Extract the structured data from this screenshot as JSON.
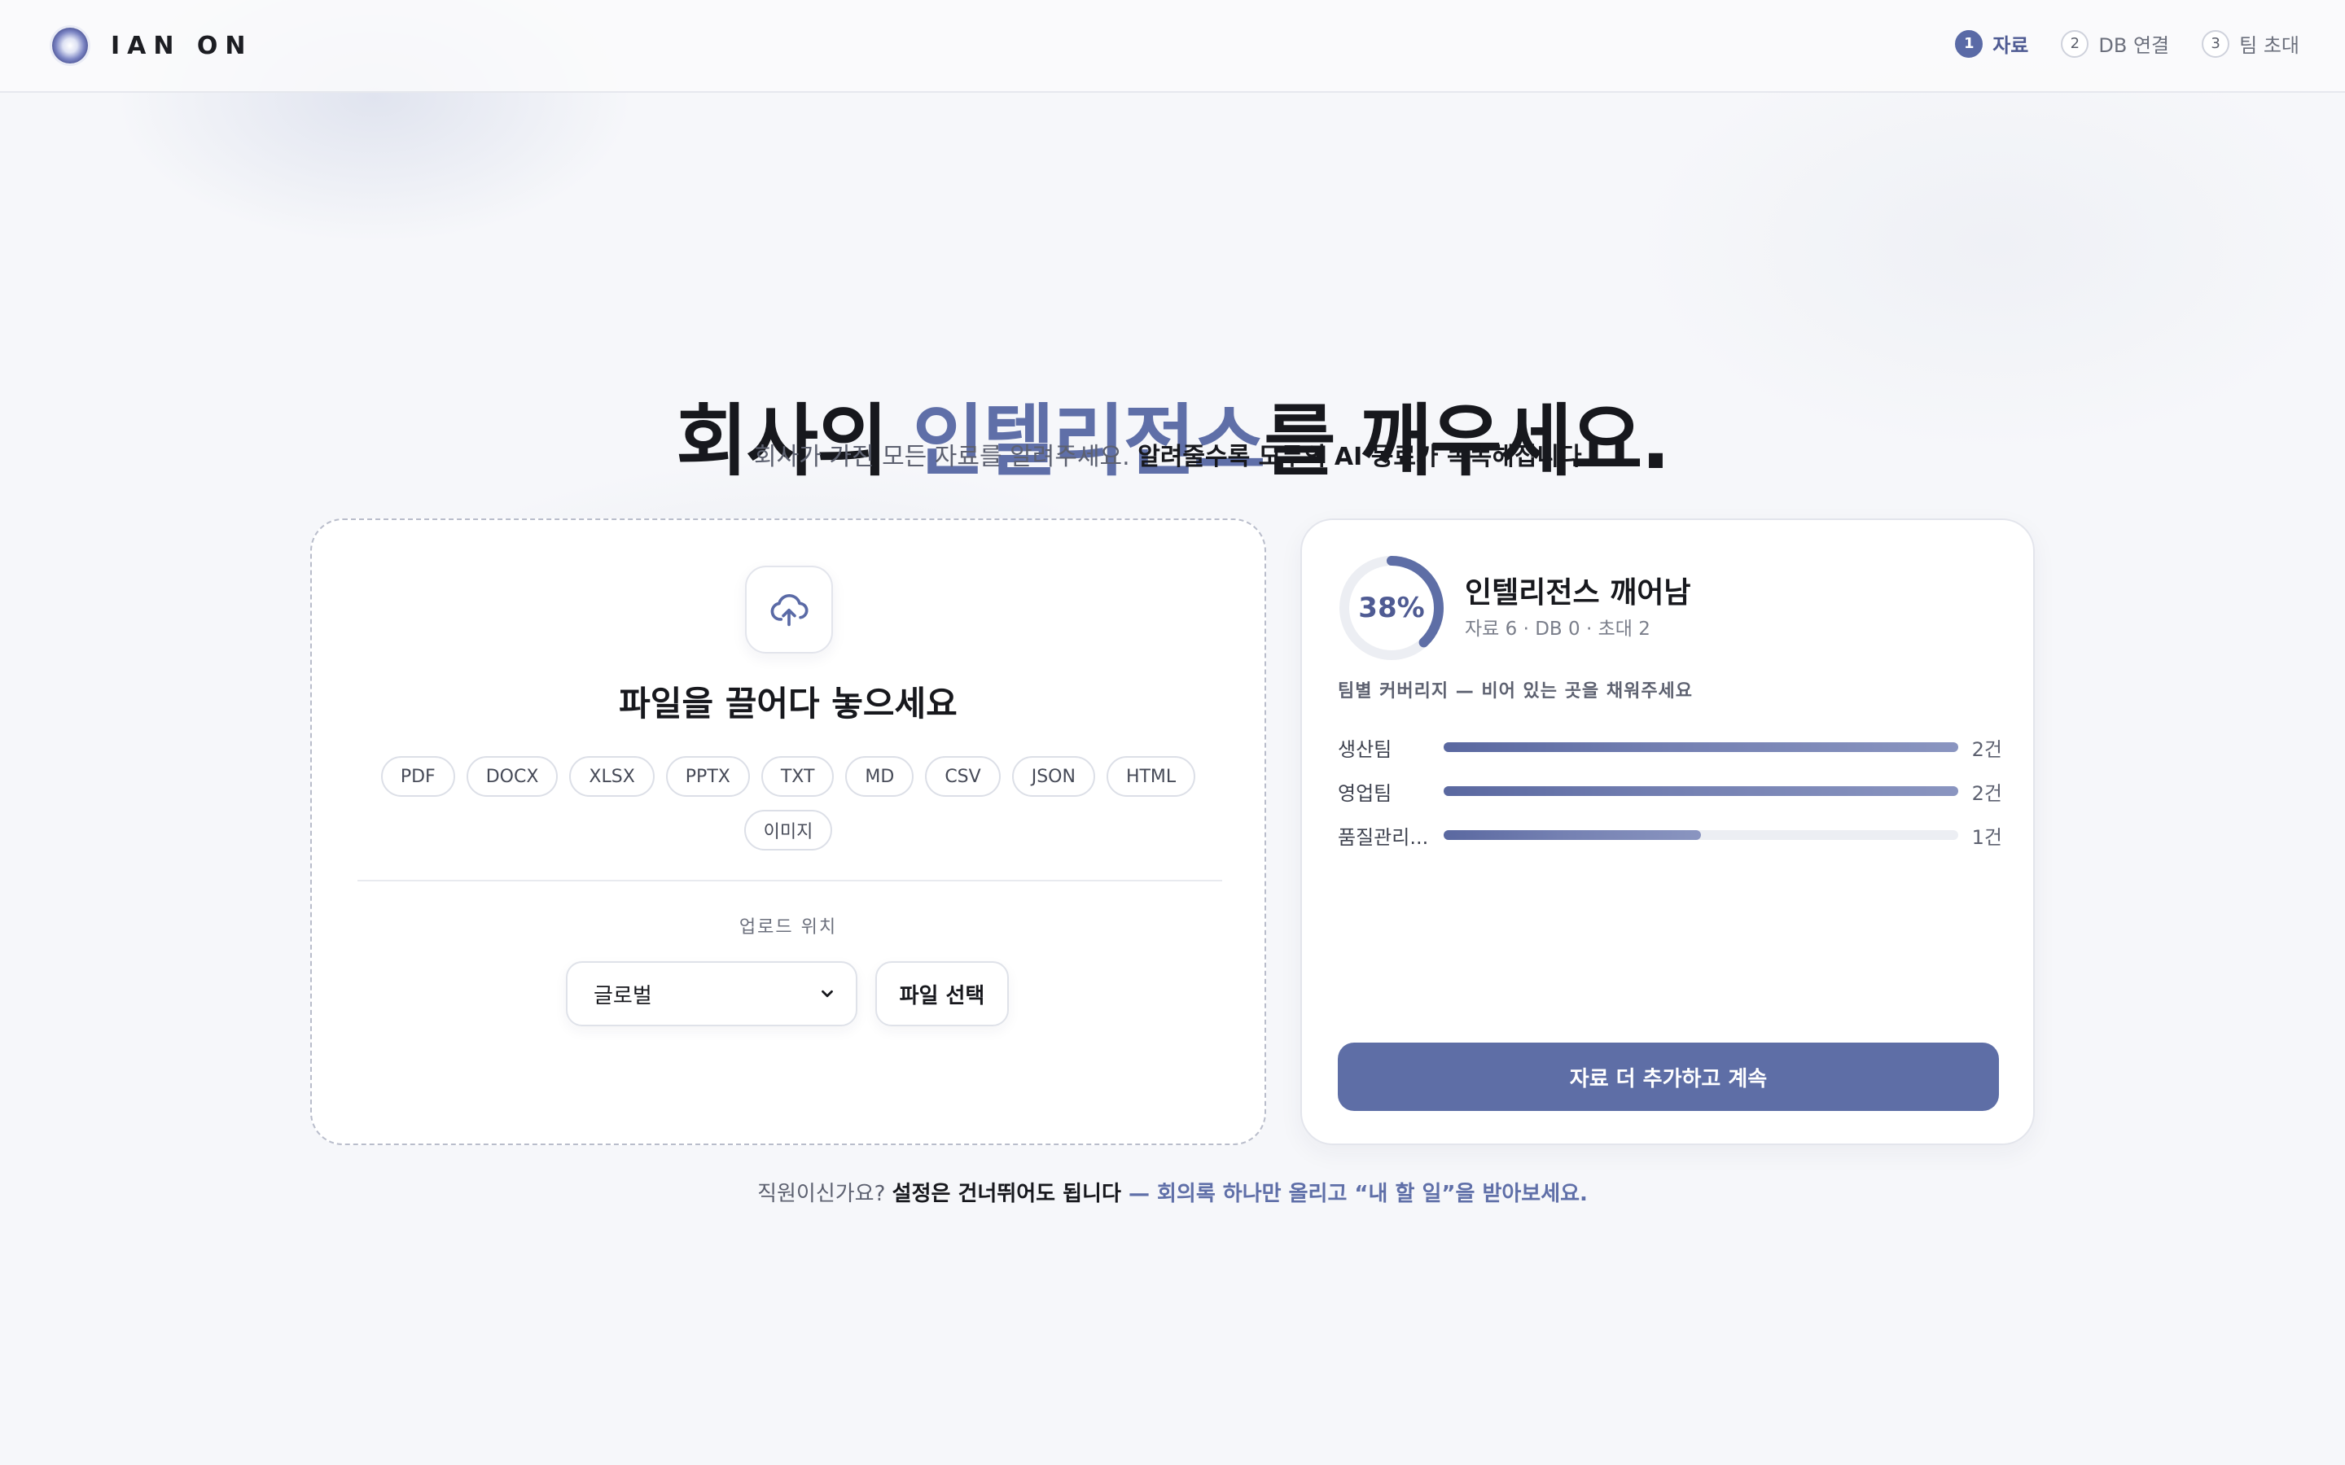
{
  "brand": {
    "name": "IAN ON"
  },
  "steps": [
    {
      "num": "1",
      "label": "자료",
      "active": true
    },
    {
      "num": "2",
      "label": "DB 연결",
      "active": false
    },
    {
      "num": "3",
      "label": "팀 초대",
      "active": false
    }
  ],
  "hero": {
    "title_pre": "회사의 ",
    "title_accent": "인텔리전스",
    "title_post": "를 깨우세요.",
    "subtitle_plain": "회사가 가진 모든 자료를 알려주세요. ",
    "subtitle_bold": "알려줄수록 모두의 AI 동료가 똑똑해집니다."
  },
  "upload": {
    "drop_title": "파일을 끌어다 놓으세요",
    "formats": [
      "PDF",
      "DOCX",
      "XLSX",
      "PPTX",
      "TXT",
      "MD",
      "CSV",
      "JSON",
      "HTML",
      "이미지"
    ],
    "location_label": "업로드 위치",
    "location_value": "글로벌",
    "file_button": "파일 선택",
    "icon": "cloud-upload-icon"
  },
  "progress": {
    "percent_label": "38%",
    "percent": 0.38,
    "title": "인텔리전스 깨어남",
    "summary": "자료 6 · DB 0 · 초대 2",
    "coverage_title": "팀별 커버리지 — 비어 있는 곳을 채워주세요",
    "teams": [
      {
        "name": "생산팀",
        "count": "2건",
        "fill": 1.0
      },
      {
        "name": "영업팀",
        "count": "2건",
        "fill": 1.0
      },
      {
        "name": "품질관리...",
        "count": "1건",
        "fill": 0.5
      }
    ],
    "continue_button": "자료 더 추가하고 계속",
    "accent_color": "#5e6ea6"
  },
  "footer": {
    "question": "직원이신가요? ",
    "bold": "설정은 건너뛰어도 됩니다",
    "link": " — 회의록 하나만 올리고 “내 할 일”을 받아보세요."
  }
}
